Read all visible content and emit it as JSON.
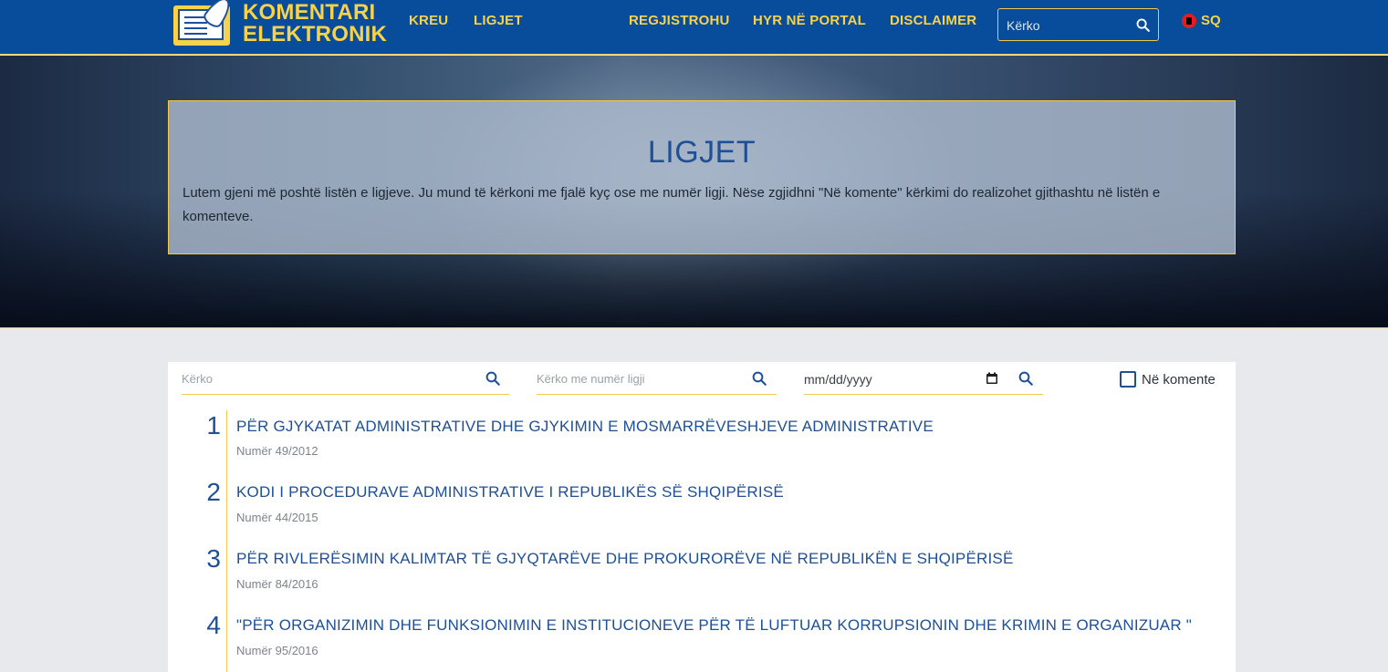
{
  "header": {
    "logo_line1": "KOMENTARI",
    "logo_line2": "ELEKTRONIK",
    "nav": [
      "KREU",
      "LIGJET",
      "REGJISTROHU",
      "HYR NË PORTAL",
      "DISCLAIMER"
    ],
    "search_placeholder": "Kërko",
    "lang": "SQ"
  },
  "hero": {
    "title": "LIGJET",
    "description": "Lutem gjeni më poshtë listën e ligjeve. Ju mund të kërkoni me fjalë kyç ose me numër ligji. Nëse zgjidhni \"Në komente\" kërkimi do realizohet gjithashtu në listën e komenteve."
  },
  "filters": {
    "keyword_placeholder": "Kërko",
    "number_placeholder": "Kërko me numër ligji",
    "date_placeholder": "mm/dd/yyyy",
    "in_comments_label": "Në komente"
  },
  "laws": [
    {
      "index": "1",
      "title": "PËR GJYKATAT ADMINISTRATIVE DHE GJYKIMIN E MOSMARRËVESHJEVE ADMINISTRATIVE",
      "number": "Numër 49/2012"
    },
    {
      "index": "2",
      "title": "KODI I PROCEDURAVE ADMINISTRATIVE I REPUBLIKËS SË SHQIPËRISË",
      "number": "Numër 44/2015"
    },
    {
      "index": "3",
      "title": "PËR RIVLERËSIMIN KALIMTAR TË GJYQTARËVE DHE PROKURORËVE NË REPUBLIKËN E SHQIPËRISË",
      "number": "Numër 84/2016"
    },
    {
      "index": "4",
      "title": "\"PËR ORGANIZIMIN DHE FUNKSIONIMIN E INSTITUCIONEVE PËR TË LUFTUAR KORRUPSIONIN DHE KRIMIN E ORGANIZUAR \"",
      "number": "Numër 95/2016"
    }
  ],
  "colors": {
    "primary": "#084c9c",
    "accent": "#f7d24a",
    "text_blue": "#1f4f95"
  }
}
